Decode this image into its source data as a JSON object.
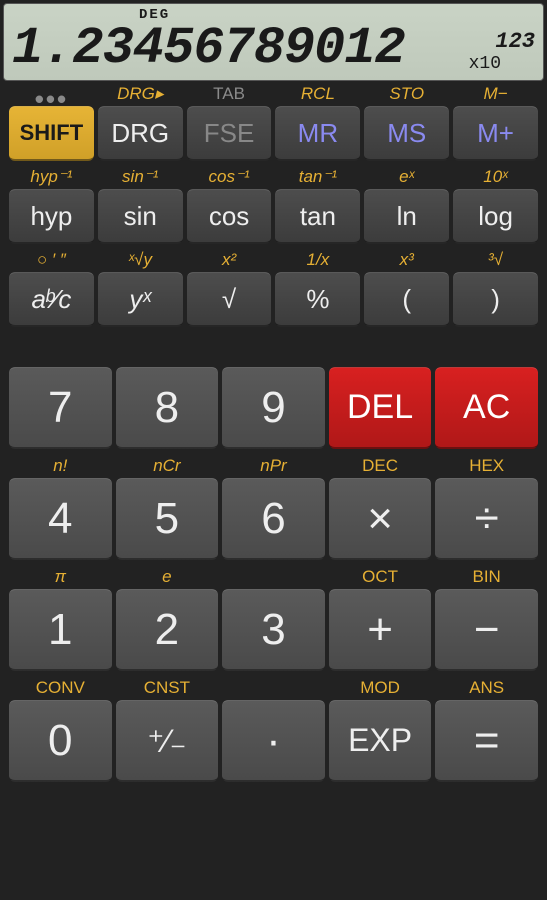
{
  "display": {
    "mode": "DEG",
    "main": "1.23456789012",
    "exp_label": "x10",
    "exp": "123"
  },
  "sec": {
    "r1": {
      "menu": "•••",
      "drg": "DRG▸",
      "tab": "TAB",
      "rcl": "RCL",
      "sto": "STO",
      "mminus": "M−"
    },
    "r2": {
      "hypinv": "hyp⁻¹",
      "sininv": "sin⁻¹",
      "cosinv": "cos⁻¹",
      "taninv": "tan⁻¹",
      "ex": "eˣ",
      "tenx": "10ˣ"
    },
    "r3": {
      "dms": "○ ′ ″",
      "xrt": "ˣ√y",
      "x2": "x²",
      "inv": "1/x",
      "x3": "x³",
      "crt": "³√"
    },
    "r5": {
      "nfact": "n!",
      "ncr": "nCr",
      "npr": "nPr",
      "dec": "DEC",
      "hex": "HEX"
    },
    "r6": {
      "pi": "π",
      "e": "e",
      "oct": "OCT",
      "bin": "BIN"
    },
    "r7": {
      "conv": "CONV",
      "cnst": "CNST",
      "mod": "MOD",
      "ans": "ANS"
    }
  },
  "keys": {
    "shift": "SHIFT",
    "drg": "DRG",
    "fse": "FSE",
    "mr": "MR",
    "ms": "MS",
    "mplus": "M+",
    "hyp": "hyp",
    "sin": "sin",
    "cos": "cos",
    "tan": "tan",
    "ln": "ln",
    "log": "log",
    "abc": "aᵇ⁄c",
    "yx": "yˣ",
    "sqrt": "√",
    "pct": "%",
    "lpar": "(",
    "rpar": ")",
    "k7": "7",
    "k8": "8",
    "k9": "9",
    "del": "DEL",
    "ac": "AC",
    "k4": "4",
    "k5": "5",
    "k6": "6",
    "mul": "×",
    "div": "÷",
    "k1": "1",
    "k2": "2",
    "k3": "3",
    "add": "+",
    "sub": "−",
    "k0": "0",
    "neg": "⁺⁄₋",
    "dot": "·",
    "exp": "EXP",
    "eq": "="
  }
}
